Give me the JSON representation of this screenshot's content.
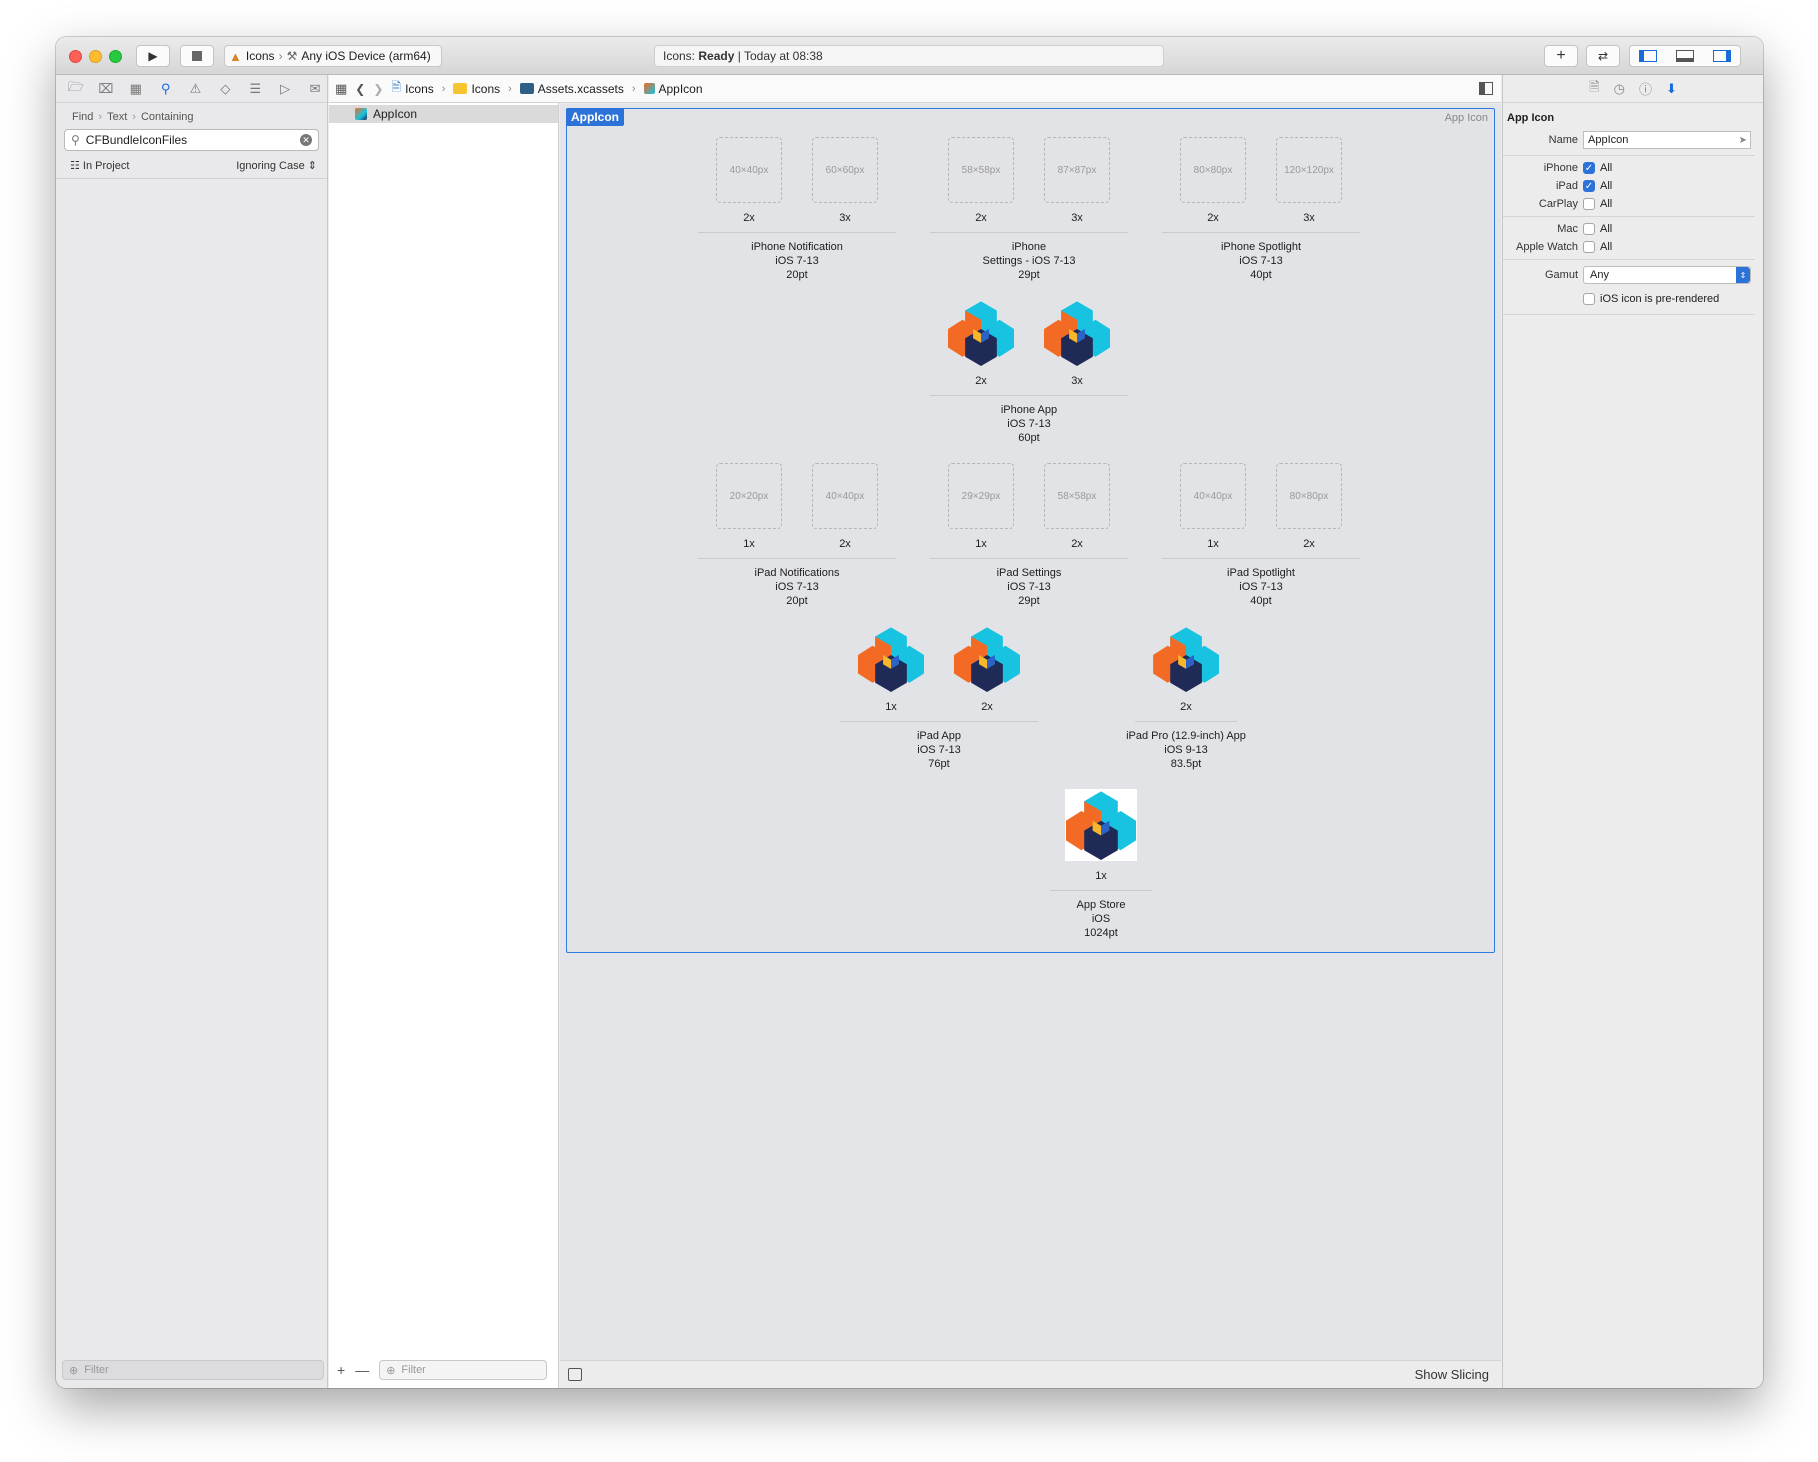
{
  "toolbar": {
    "scheme_project": "Icons",
    "scheme_device": "Any iOS Device (arm64)",
    "status_prefix": "Icons:",
    "status_state": "Ready",
    "status_time": "| Today at 08:38"
  },
  "navigator": {
    "find_path": [
      "Find",
      "Text",
      "Containing"
    ],
    "search_value": "CFBundleIconFiles",
    "scope": "In Project",
    "case_mode": "Ignoring Case",
    "filter_placeholder": "Filter"
  },
  "jumpbar": {
    "crumbs": [
      "Icons",
      "Icons",
      "Assets.xcassets",
      "AppIcon"
    ]
  },
  "asset_list": {
    "items": [
      "AppIcon"
    ],
    "filter_placeholder": "Filter"
  },
  "editor": {
    "set_name": "AppIcon",
    "set_kind": "App Icon",
    "show_slicing": "Show Slicing",
    "groups": [
      {
        "slots": [
          {
            "size": "40×40px",
            "scale": "2x"
          },
          {
            "size": "60×60px",
            "scale": "3x"
          }
        ],
        "label": [
          "iPhone Notification",
          "iOS 7-13",
          "20pt"
        ]
      },
      {
        "slots": [
          {
            "size": "58×58px",
            "scale": "2x"
          },
          {
            "size": "87×87px",
            "scale": "3x"
          }
        ],
        "label": [
          "iPhone",
          "Settings - iOS 7-13",
          "29pt"
        ]
      },
      {
        "slots": [
          {
            "size": "80×80px",
            "scale": "2x"
          },
          {
            "size": "120×120px",
            "scale": "3x"
          }
        ],
        "label": [
          "iPhone Spotlight",
          "iOS 7-13",
          "40pt"
        ]
      },
      {
        "slots": [
          {
            "icon": true,
            "scale": "2x"
          },
          {
            "icon": true,
            "scale": "3x"
          }
        ],
        "label": [
          "iPhone App",
          "iOS 7-13",
          "60pt"
        ]
      },
      {
        "slots": [
          {
            "size": "20×20px",
            "scale": "1x"
          },
          {
            "size": "40×40px",
            "scale": "2x"
          }
        ],
        "label": [
          "iPad Notifications",
          "iOS 7-13",
          "20pt"
        ]
      },
      {
        "slots": [
          {
            "size": "29×29px",
            "scale": "1x"
          },
          {
            "size": "58×58px",
            "scale": "2x"
          }
        ],
        "label": [
          "iPad Settings",
          "iOS 7-13",
          "29pt"
        ]
      },
      {
        "slots": [
          {
            "size": "40×40px",
            "scale": "1x"
          },
          {
            "size": "80×80px",
            "scale": "2x"
          }
        ],
        "label": [
          "iPad Spotlight",
          "iOS 7-13",
          "40pt"
        ]
      },
      {
        "slots": [
          {
            "icon": true,
            "scale": "1x"
          },
          {
            "icon": true,
            "scale": "2x"
          }
        ],
        "label": [
          "iPad App",
          "iOS 7-13",
          "76pt"
        ]
      },
      {
        "slots": [
          {
            "icon": true,
            "scale": "2x"
          }
        ],
        "label": [
          "iPad Pro (12.9-inch) App",
          "iOS 9-13",
          "83.5pt"
        ]
      },
      {
        "slots": [
          {
            "icon": true,
            "white": true,
            "scale": "1x"
          }
        ],
        "label": [
          "App Store",
          "iOS",
          "1024pt"
        ]
      }
    ]
  },
  "inspector": {
    "section_title": "App Icon",
    "name_label": "Name",
    "name_value": "AppIcon",
    "rows": [
      {
        "label": "iPhone",
        "checked": true,
        "text": "All"
      },
      {
        "label": "iPad",
        "checked": true,
        "text": "All"
      },
      {
        "label": "CarPlay",
        "checked": false,
        "text": "All"
      },
      {
        "label": "Mac",
        "checked": false,
        "text": "All"
      },
      {
        "label": "Apple Watch",
        "checked": false,
        "text": "All"
      }
    ],
    "gamut_label": "Gamut",
    "gamut_value": "Any",
    "prerendered_label": "iOS icon is pre-rendered"
  },
  "colors": {
    "accent": "#2b73d9",
    "icon_orange": "#f26a24",
    "icon_teal": "#17c3e0",
    "icon_navy": "#1f2b56",
    "icon_yellow": "#f8b62a"
  }
}
